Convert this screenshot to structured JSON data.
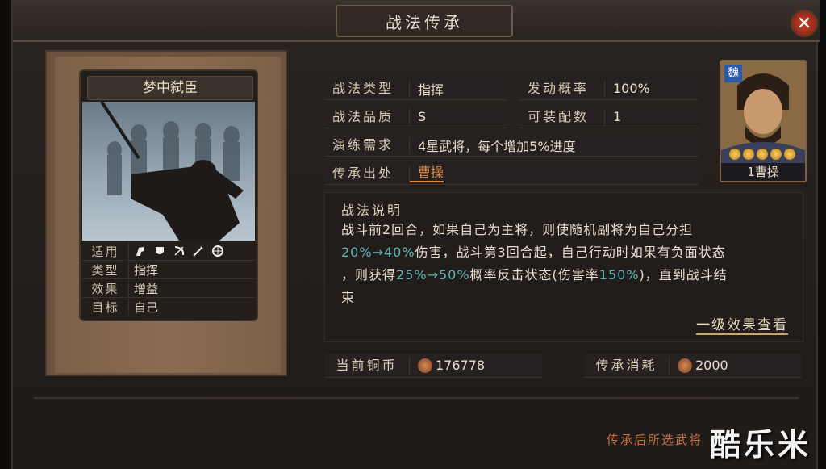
{
  "window": {
    "title": "战法传承"
  },
  "card": {
    "name": "梦中弑臣",
    "rows": [
      {
        "key": "适用",
        "value": ""
      },
      {
        "key": "类型",
        "value": "指挥"
      },
      {
        "key": "效果",
        "value": "增益"
      },
      {
        "key": "目标",
        "value": "自己"
      }
    ],
    "applicable_icons": [
      "cavalry-icon",
      "shield-icon",
      "bow-icon",
      "spear-icon",
      "wheel-icon"
    ]
  },
  "info": {
    "type_label": "战法类型",
    "type_value": "指挥",
    "rate_label": "发动概率",
    "rate_value": "100%",
    "quality_label": "战法品质",
    "quality_value": "S",
    "equip_label": "可装配数",
    "equip_value": "1",
    "train_label": "演练需求",
    "train_value": "4星武将，每个增加5%进度",
    "source_label": "传承出处",
    "source_value": "曹操"
  },
  "general": {
    "faction": "魏",
    "name": "1曹操",
    "stars": 5
  },
  "description": {
    "title": "战法说明",
    "p1": "战斗前2回合，如果自己为主将，则使随机副将为自己分担",
    "p2a": "20%→40%",
    "p2b": "伤害，战斗第3回合起，自己行动时如果有负面状态",
    "p3a": "，则获得",
    "p3b": "25%→50%",
    "p3c": "概率反击状态(伤害率",
    "p3d": "150%",
    "p3e": ")，直到战斗结",
    "p4": "束",
    "view_link": "一级效果查看"
  },
  "costs": {
    "current_label": "当前铜币",
    "current_value": "176778",
    "consume_label": "传承消耗",
    "consume_value": "2000"
  },
  "footer": {
    "note": "传承后所选武将",
    "watermark": "酷乐米"
  },
  "colors": {
    "highlight": "#5fb7b6",
    "source_link": "#e08a40",
    "close": "#c8432c"
  }
}
